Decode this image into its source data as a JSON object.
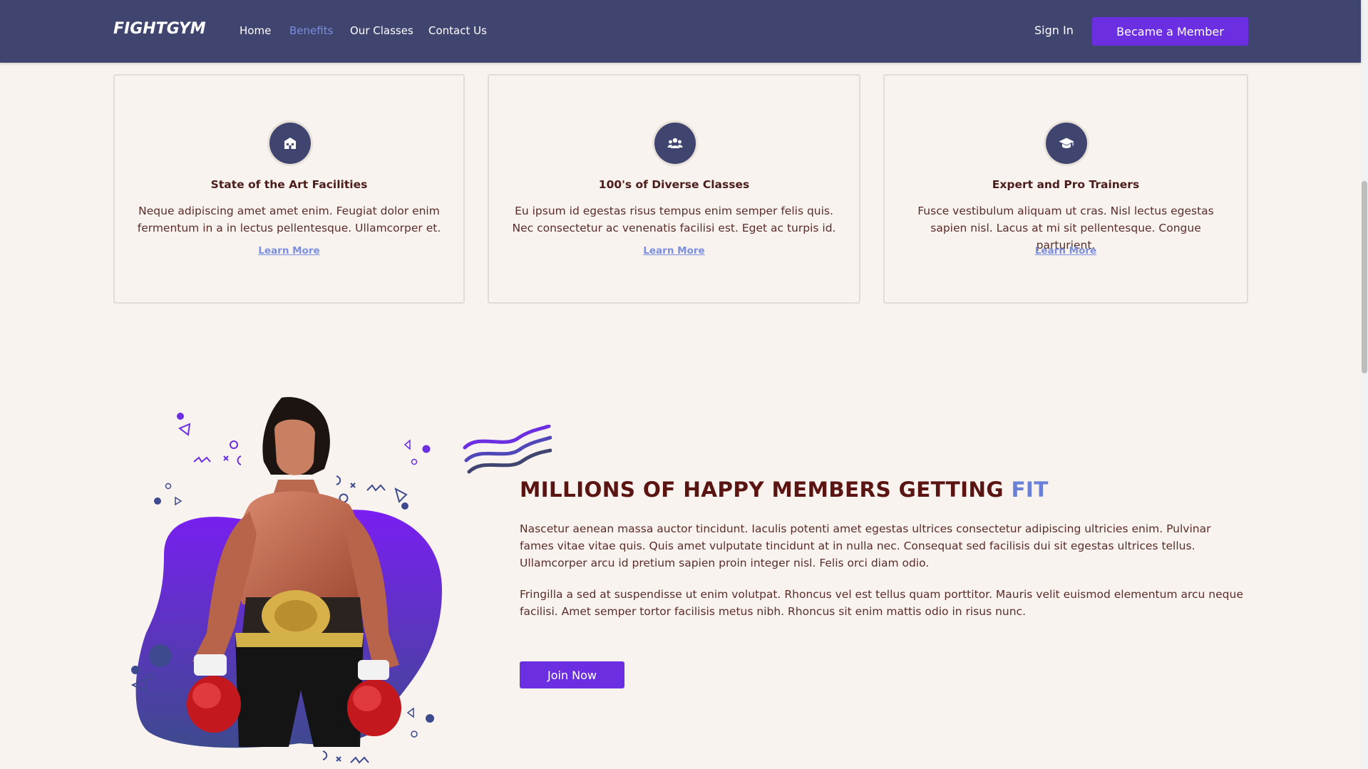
{
  "header": {
    "logo": "FIGHTGYM",
    "nav": {
      "home": "Home",
      "benefits": "Benefits",
      "classes": "Our Classes",
      "contact": "Contact Us"
    },
    "signin": "Sign In",
    "member_button": "Became a Member"
  },
  "cards": [
    {
      "icon": "building-icon",
      "title": "State of the Art Facilities",
      "text": "Neque adipiscing amet amet enim. Feugiat dolor enim fermentum in a in lectus pellentesque. Ullamcorper et.",
      "link": "Learn More"
    },
    {
      "icon": "group-icon",
      "title": "100's of Diverse Classes",
      "text": "Eu ipsum id egestas risus tempus enim semper felis quis. Nec consectetur ac venenatis facilisi est. Eget ac turpis id.",
      "link": "Learn More"
    },
    {
      "icon": "graduation-cap-icon",
      "title": "Expert and Pro Trainers",
      "text": "Fusce vestibulum aliquam ut cras. Nisl lectus egestas sapien nisl. Lacus at mi sit pellentesque. Congue parturient.",
      "link": "Learn More"
    }
  ],
  "hero": {
    "title_main": "MILLIONS OF HAPPY MEMBERS GETTING",
    "title_accent": "FIT",
    "para1": "Nascetur aenean massa auctor tincidunt. Iaculis potenti amet egestas ultrices consectetur adipiscing ultricies enim. Pulvinar fames vitae vitae quis. Quis amet vulputate tincidunt at in nulla nec. Consequat sed facilisis dui sit egestas ultrices tellus. Ullamcorper arcu id pretium sapien proin integer nisl. Felis orci diam odio.",
    "para2": "Fringilla a sed at suspendisse ut enim volutpat. Rhoncus vel est tellus quam porttitor. Mauris velit euismod elementum arcu neque facilisi. Amet semper tortor facilisis metus nibh. Rhoncus sit enim mattis odio in risus nunc.",
    "join_button": "Join Now"
  },
  "colors": {
    "header_bg": "#40456F",
    "page_bg": "#F8F3EE",
    "primary_button": "#6B2EE0",
    "accent_link": "#7B8FDE",
    "heading_text": "#5A1412"
  }
}
